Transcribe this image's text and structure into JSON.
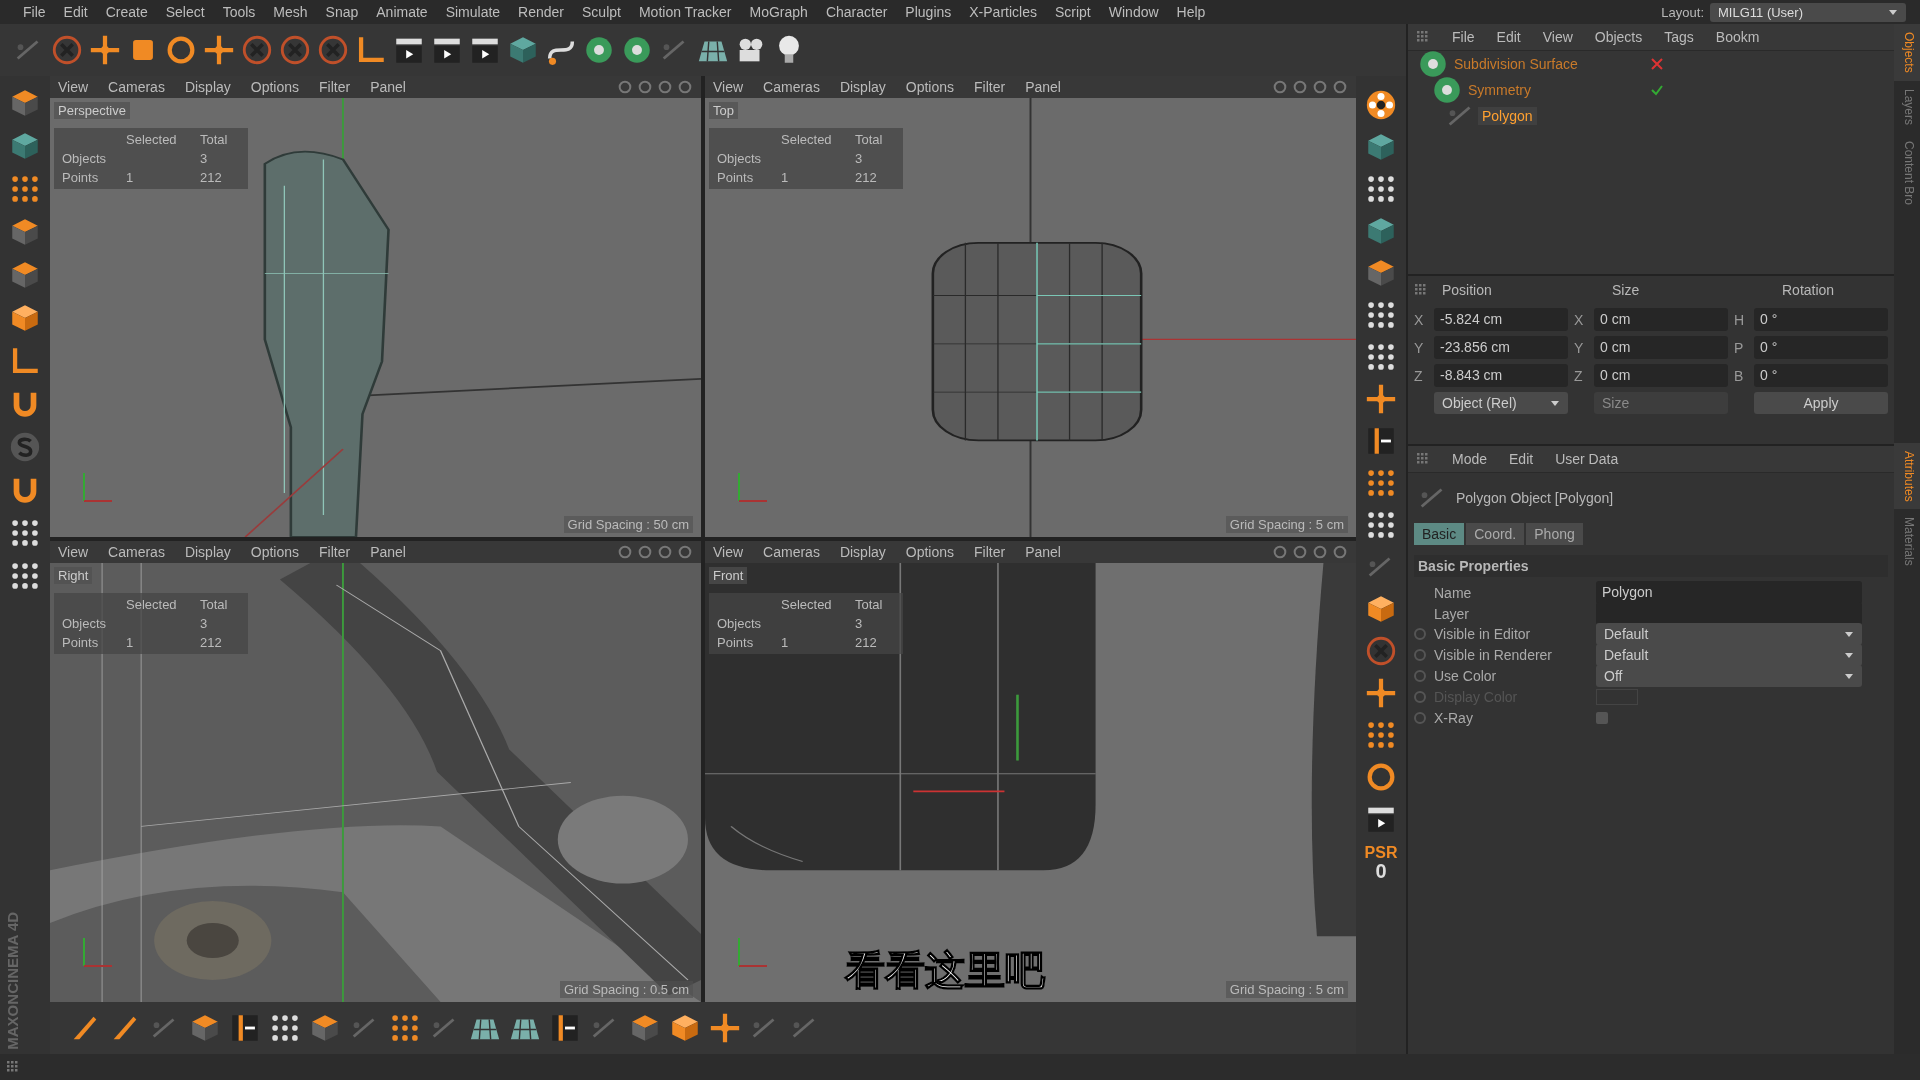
{
  "menu": [
    "File",
    "Edit",
    "Create",
    "Select",
    "Tools",
    "Mesh",
    "Snap",
    "Animate",
    "Simulate",
    "Render",
    "Sculpt",
    "Motion Tracker",
    "MoGraph",
    "Character",
    "Plugins",
    "X-Particles",
    "Script",
    "Window",
    "Help"
  ],
  "layout": {
    "label": "Layout:",
    "value": "MILG11 (User)"
  },
  "viewports": [
    {
      "menu": [
        "View",
        "Cameras",
        "Display",
        "Options",
        "Filter",
        "Panel"
      ],
      "camera": "Perspective",
      "stats": {
        "columns": [
          "Selected",
          "Total"
        ],
        "rows": [
          {
            "label": "Objects",
            "total": "3"
          },
          {
            "label": "Points",
            "selected_value": "1",
            "total": "212"
          }
        ]
      },
      "grid_spacing": "Grid Spacing : 50 cm"
    },
    {
      "menu": [
        "View",
        "Cameras",
        "Display",
        "Options",
        "Filter",
        "Panel"
      ],
      "camera": "Top",
      "stats": {
        "columns": [
          "Selected",
          "Total"
        ],
        "rows": [
          {
            "label": "Objects",
            "total": "3"
          },
          {
            "label": "Points",
            "selected_value": "1",
            "total": "212"
          }
        ]
      },
      "grid_spacing": "Grid Spacing : 5 cm"
    },
    {
      "menu": [
        "View",
        "Cameras",
        "Display",
        "Options",
        "Filter",
        "Panel"
      ],
      "camera": "Right",
      "stats": {
        "columns": [
          "Selected",
          "Total"
        ],
        "rows": [
          {
            "label": "Objects",
            "total": "3"
          },
          {
            "label": "Points",
            "selected_value": "1",
            "total": "212"
          }
        ]
      },
      "grid_spacing": "Grid Spacing : 0.5 cm"
    },
    {
      "menu": [
        "View",
        "Cameras",
        "Display",
        "Options",
        "Filter",
        "Panel"
      ],
      "camera": "Front",
      "stats": {
        "columns": [
          "Selected",
          "Total"
        ],
        "rows": [
          {
            "label": "Objects",
            "total": "3"
          },
          {
            "label": "Points",
            "selected_value": "1",
            "total": "212"
          }
        ]
      },
      "grid_spacing": "Grid Spacing : 5 cm"
    }
  ],
  "subtitle": "看看这里吧",
  "psr": {
    "label": "PSR",
    "value": "0"
  },
  "logo": {
    "brand": "MAXON",
    "product": "CINEMA 4D"
  },
  "objects": {
    "menu": [
      "File",
      "Edit",
      "View",
      "Objects",
      "Tags",
      "Bookm"
    ],
    "tree": [
      {
        "name": "Subdivision Surface",
        "selected": false,
        "enabled": false,
        "children": [
          {
            "name": "Symmetry",
            "selected": false,
            "enabled": true,
            "children": [
              {
                "name": "Polygon",
                "selected": true
              }
            ]
          }
        ]
      }
    ]
  },
  "side_tabs_top": [
    {
      "label": "Objects",
      "selected": true
    },
    {
      "label": "Layers",
      "selected": false
    },
    {
      "label": "Content Bro",
      "selected": false
    }
  ],
  "coordinates": {
    "headers": [
      "Position",
      "Size",
      "Rotation"
    ],
    "rows": [
      {
        "axis": "X",
        "position": "-5.824 cm",
        "size_axis": "X",
        "size": "0 cm",
        "rot_axis": "H",
        "rotation": "0 °"
      },
      {
        "axis": "Y",
        "position": "-23.856 cm",
        "size_axis": "Y",
        "size": "0 cm",
        "rot_axis": "P",
        "rotation": "0 °"
      },
      {
        "axis": "Z",
        "position": "-8.843 cm",
        "size_axis": "Z",
        "size": "0 cm",
        "rot_axis": "B",
        "rotation": "0 °"
      }
    ],
    "mode": "Object (Rel)",
    "size_mode": {
      "label": "Size",
      "disabled": true
    },
    "apply": "Apply"
  },
  "attributes": {
    "menu": [
      "Mode",
      "Edit",
      "User Data"
    ],
    "title": "Polygon Object [Polygon]",
    "tabs": [
      {
        "label": "Basic",
        "selected": true
      },
      {
        "label": "Coord.",
        "selected": false
      },
      {
        "label": "Phong",
        "selected": false
      }
    ],
    "section": "Basic Properties",
    "fields": [
      {
        "kind": "text",
        "label": "Name",
        "value": "Polygon",
        "disabled": false
      },
      {
        "kind": "link",
        "label": "Layer",
        "disabled": false
      },
      {
        "kind": "dropdown",
        "label": "Visible in Editor",
        "value": "Default",
        "disabled": false
      },
      {
        "kind": "dropdown",
        "label": "Visible in Renderer",
        "value": "Default",
        "disabled": false
      },
      {
        "kind": "dropdown",
        "label": "Use Color",
        "value": "Off",
        "disabled": false
      },
      {
        "kind": "color",
        "label": "Display Color",
        "disabled": true
      },
      {
        "kind": "checkbox",
        "label": "X-Ray",
        "checked": false,
        "disabled": false
      }
    ]
  },
  "side_tabs_bottom": [
    {
      "label": "Attributes",
      "selected": true
    },
    {
      "label": "Materials",
      "selected": false
    }
  ]
}
